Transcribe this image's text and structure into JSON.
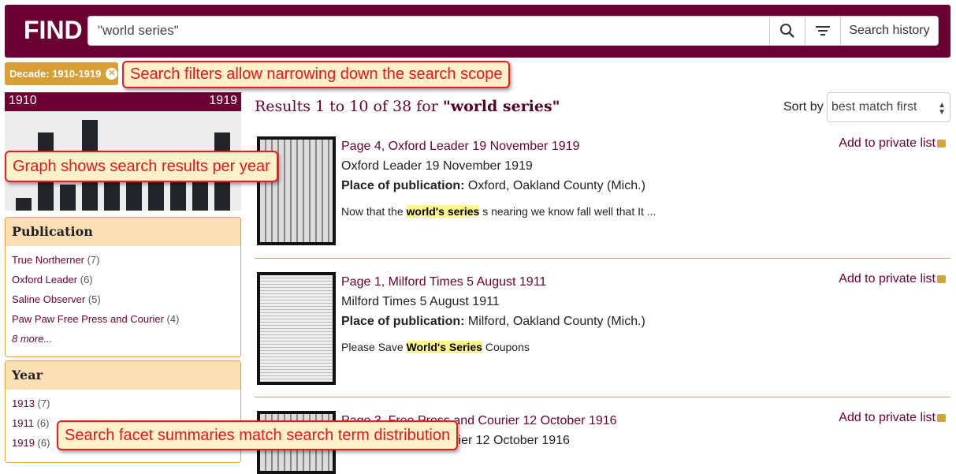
{
  "header": {
    "logo": "FIND",
    "search_value": "\"world series\"",
    "search_history_label": "Search history"
  },
  "filters": [
    {
      "label": "Decade: 1910-1919"
    }
  ],
  "callouts": {
    "filters": "Search filters allow narrowing down the search scope",
    "graph": "Graph shows search results per year",
    "facets": "Search facet summaries match search term distribution"
  },
  "graph": {
    "start_label": "1910",
    "end_label": "1919",
    "chart_data": {
      "type": "bar",
      "categories": [
        "1910",
        "1911",
        "1912",
        "1913",
        "1914",
        "1915",
        "1916",
        "1917",
        "1918",
        "1919"
      ],
      "values": [
        1,
        6,
        2,
        7,
        3,
        4,
        3,
        3,
        3,
        6
      ],
      "bar_color": "#212529"
    }
  },
  "publication": {
    "title": "Publication",
    "items": [
      {
        "label": "True Northerner",
        "count": "(7)"
      },
      {
        "label": "Oxford Leader",
        "count": "(6)"
      },
      {
        "label": "Saline Observer",
        "count": "(5)"
      },
      {
        "label": "Paw Paw Free Press and Courier",
        "count": "(4)"
      }
    ],
    "more": "8 more..."
  },
  "year": {
    "title": "Year",
    "items": [
      {
        "label": "1913",
        "count": "(7)"
      },
      {
        "label": "1911",
        "count": "(6)"
      },
      {
        "label": "1919",
        "count": "(6)"
      }
    ]
  },
  "results": {
    "summary_prefix": "Results 1 to 10 of 38 for ",
    "query": "\"world series\"",
    "sort_label": "Sort by",
    "sort_value": "best match first",
    "add_label": "Add to private list",
    "items": [
      {
        "title": "Page 4, Oxford Leader 19 November 1919",
        "issue": "Oxford Leader 19 November 1919",
        "place_label": "Place of publication:",
        "place": "Oxford, Oakland County (Mich.)",
        "snip_before": "Now that the ",
        "snip_hit": "world's series",
        "snip_after": " s nearing we know fall well that It ..."
      },
      {
        "title": "Page 1, Milford Times 5 August 1911",
        "issue": "Milford Times 5 August 1911",
        "place_label": "Place of publication:",
        "place": "Milford, Oakland County (Mich.)",
        "snip_before": "Please Save ",
        "snip_hit": "World's Series",
        "snip_after": " Coupons"
      },
      {
        "title": "Page 3, Free Press and Courier 12 October 1916",
        "issue": "Free Press and Courier 12 October 1916"
      }
    ]
  },
  "colors": {
    "brand": "#6b0033",
    "accent": "#d99f37",
    "highlight": "#fff68a"
  }
}
